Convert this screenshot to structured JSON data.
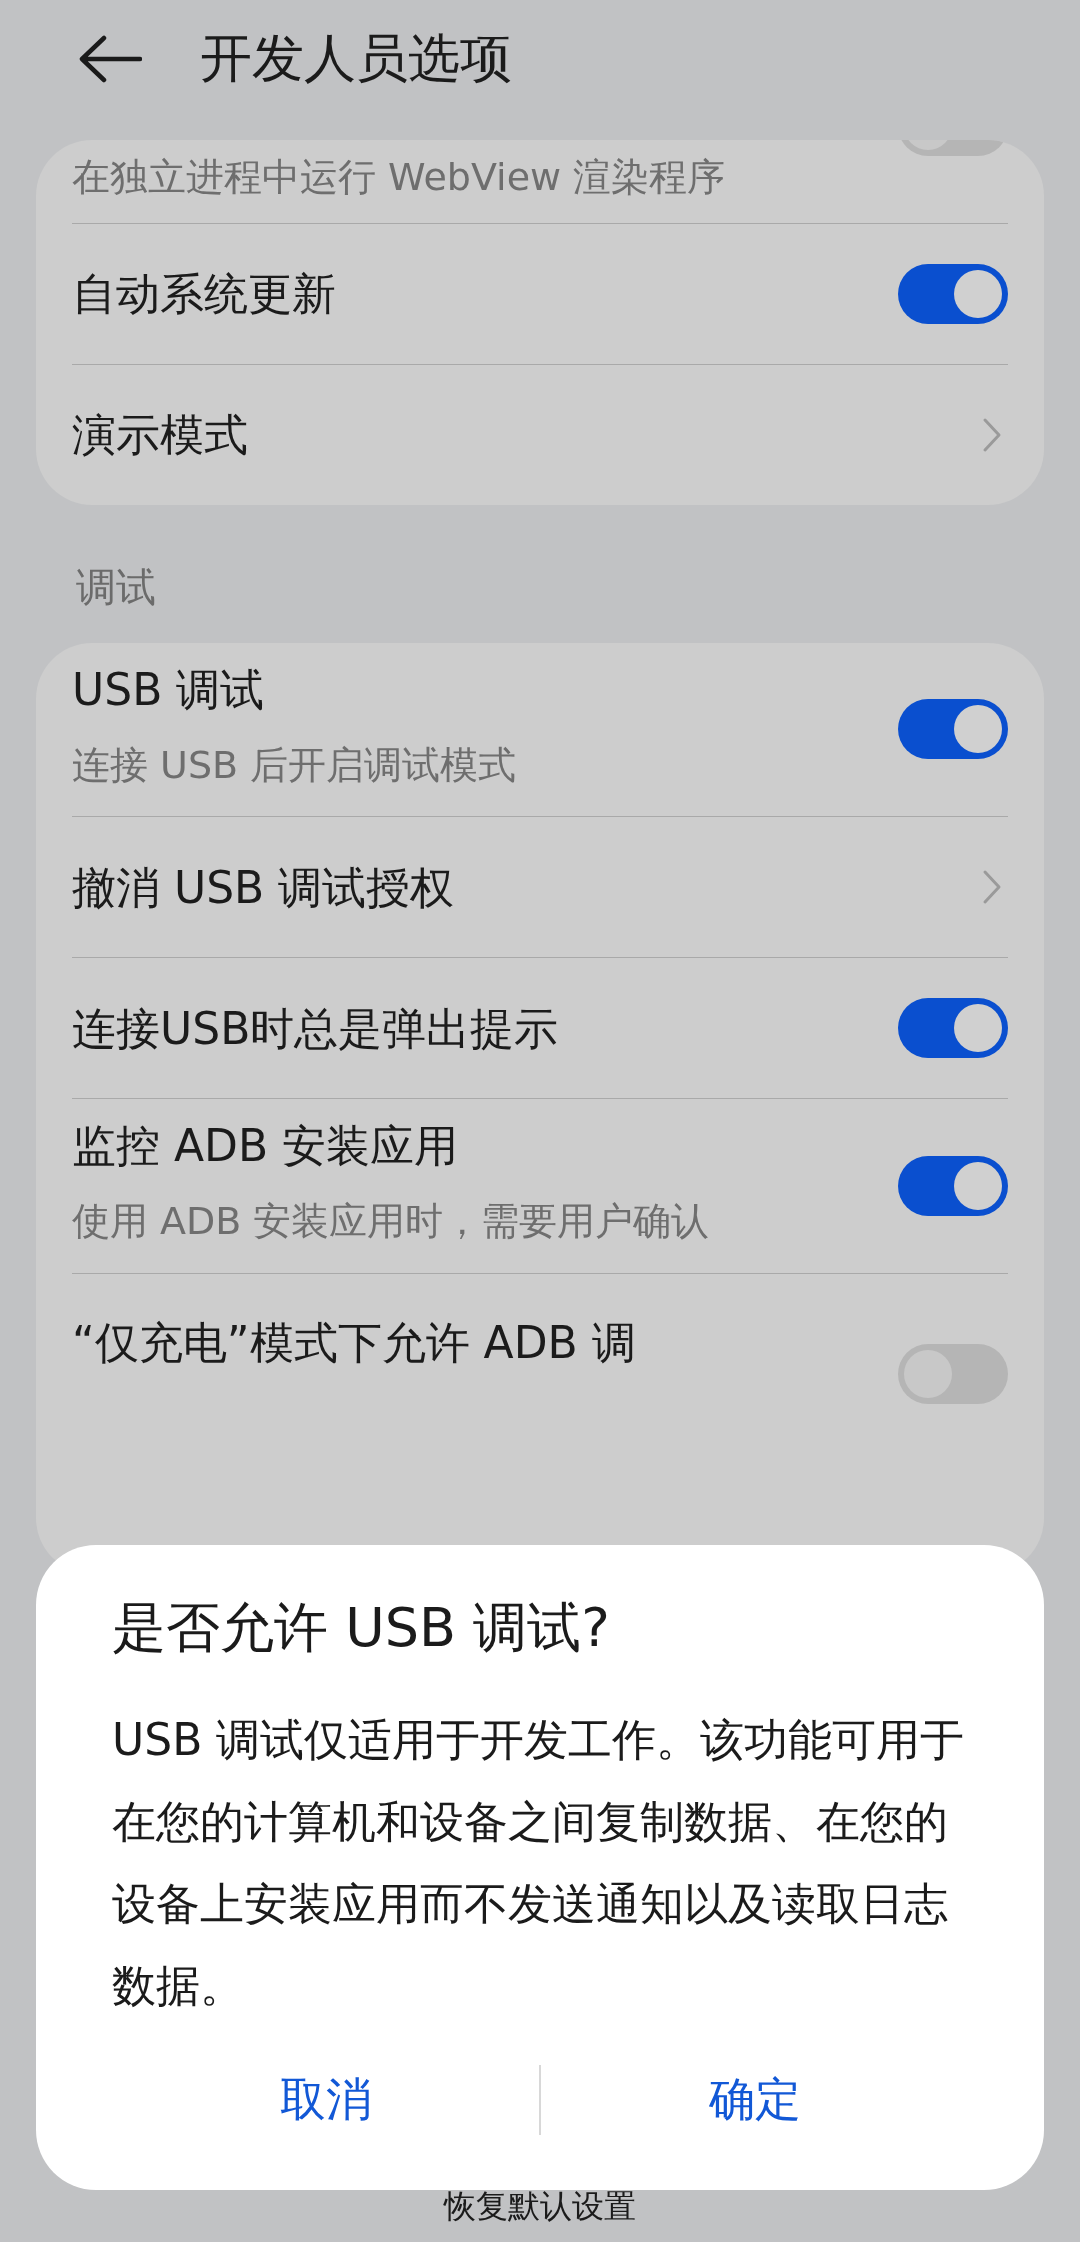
{
  "header": {
    "title": "开发人员选项"
  },
  "groups": [
    {
      "items": [
        {
          "kind": "toggle",
          "subtitle": "在独立进程中运行 WebView 渲染程序",
          "on": false
        },
        {
          "kind": "toggle",
          "title": "自动系统更新",
          "on": true
        },
        {
          "kind": "link",
          "title": "演示模式"
        }
      ]
    },
    {
      "label": "调试",
      "items": [
        {
          "kind": "toggle",
          "title": "USB 调试",
          "subtitle": "连接 USB 后开启调试模式",
          "on": true
        },
        {
          "kind": "link",
          "title": "撤消 USB 调试授权"
        },
        {
          "kind": "toggle",
          "title": "连接USB时总是弹出提示",
          "on": true
        },
        {
          "kind": "toggle",
          "title": "监控 ADB 安装应用",
          "subtitle": "使用 ADB 安装应用时，需要用户确认",
          "on": true
        },
        {
          "kind": "toggle",
          "title": "“仅充电”模式下允许 ADB 调",
          "on": false
        }
      ]
    }
  ],
  "footer": {
    "label": "恢复默认设置"
  },
  "dialog": {
    "title": "是否允许 USB 调试?",
    "message": "USB 调试仅适用于开发工作。该功能可用于在您的计算机和设备之间复制数据、在您的设备上安装应用而不发送通知以及读取日志数据。",
    "buttons": [
      "取消",
      "确定"
    ]
  }
}
